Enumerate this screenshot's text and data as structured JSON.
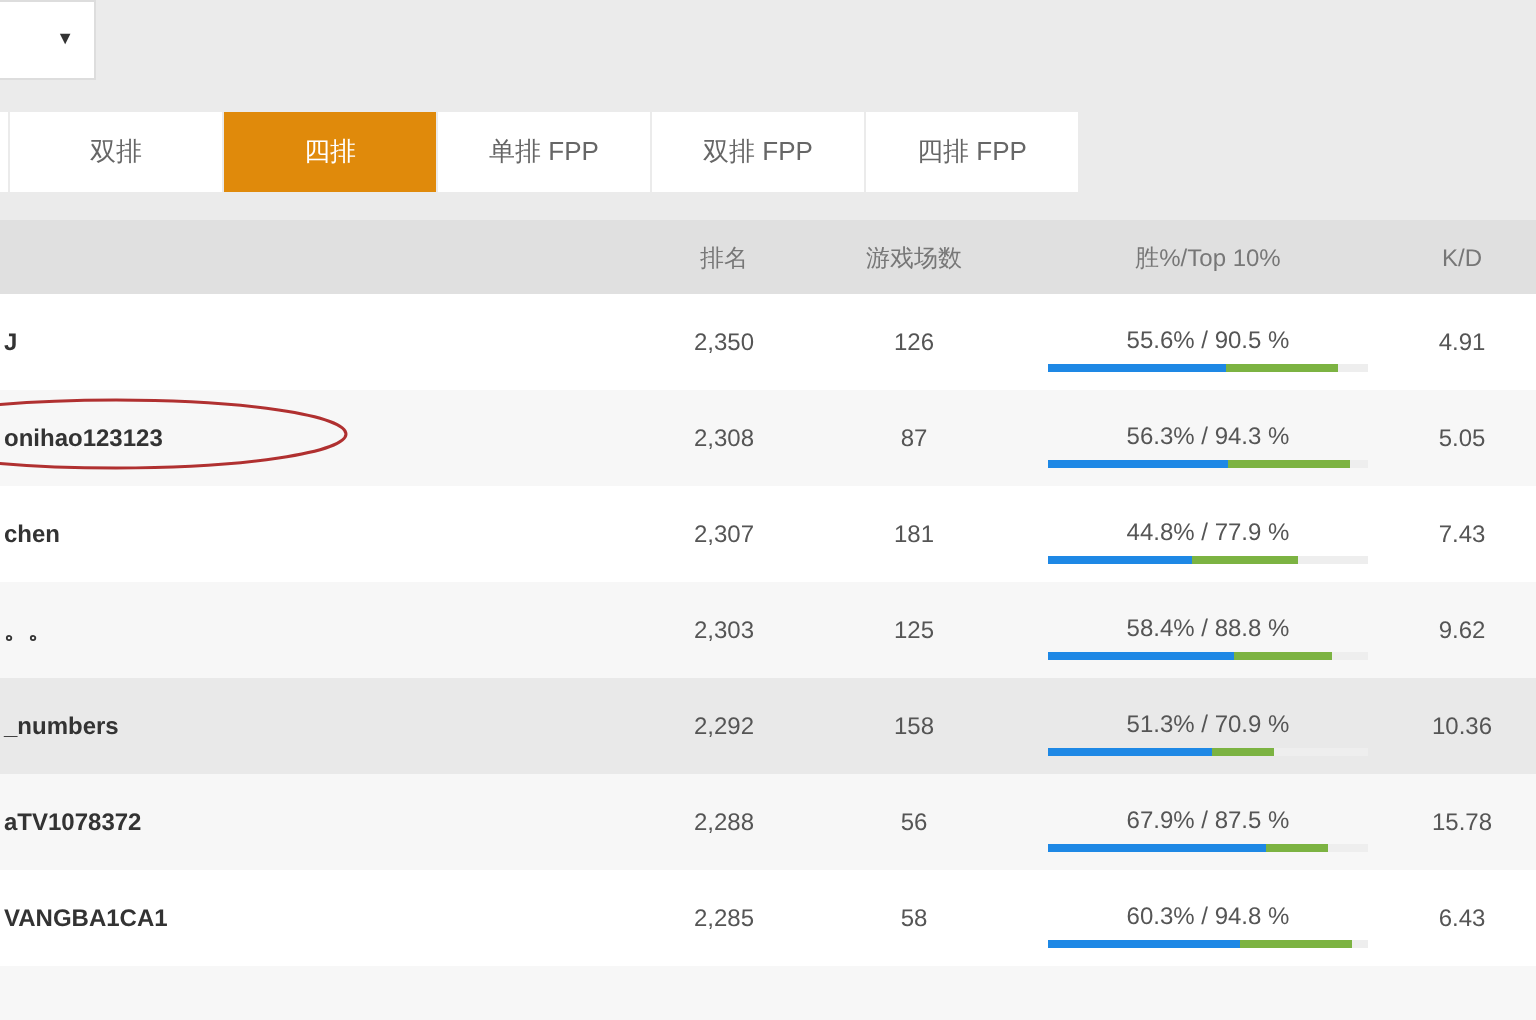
{
  "dropdown": {
    "caret": "▼"
  },
  "tabs": [
    {
      "selected": false
    },
    {
      "label": "双排",
      "selected": false
    },
    {
      "label": "四排",
      "selected": true
    },
    {
      "label": "单排 FPP",
      "selected": false
    },
    {
      "label": "双排 FPP",
      "selected": false
    },
    {
      "label": "四排 FPP",
      "selected": false
    }
  ],
  "table": {
    "columns": [
      "排名",
      "游戏场数",
      "胜%/Top 10%",
      "K/D"
    ],
    "rows": [
      {
        "name": "J",
        "rank": "2,350",
        "games": "126",
        "win_top": "55.6% / 90.5 %",
        "win_bar": {
          "level": 0.556
        },
        "top10_bar": {
          "level": 0.905
        },
        "kd": "4.91",
        "circled": false,
        "hovered": false
      },
      {
        "name": "onihao123123",
        "rank": "2,308",
        "games": "87",
        "win_top": "56.3% / 94.3 %",
        "win_bar": {
          "level": 0.563
        },
        "top10_bar": {
          "level": 0.943
        },
        "kd": "5.05",
        "circled": true,
        "hovered": false
      },
      {
        "name": "chen",
        "rank": "2,307",
        "games": "181",
        "win_top": "44.8% / 77.9 %",
        "win_bar": {
          "level": 0.448
        },
        "top10_bar": {
          "level": 0.779
        },
        "kd": "7.43",
        "circled": false,
        "hovered": false
      },
      {
        "name": "。。",
        "rank": "2,303",
        "games": "125",
        "win_top": "58.4% / 88.8 %",
        "win_bar": {
          "level": 0.584
        },
        "top10_bar": {
          "level": 0.888
        },
        "kd": "9.62",
        "circled": false,
        "hovered": false
      },
      {
        "name": "_numbers",
        "rank": "2,292",
        "games": "158",
        "win_top": "51.3% / 70.9 %",
        "win_bar": {
          "level": 0.513
        },
        "top10_bar": {
          "level": 0.709
        },
        "kd": "10.36",
        "circled": false,
        "hovered": true
      },
      {
        "name": "aTV1078372",
        "rank": "2,288",
        "games": "56",
        "win_top": "67.9% / 87.5 %",
        "win_bar": {
          "level": 0.679
        },
        "top10_bar": {
          "level": 0.875
        },
        "kd": "15.78",
        "circled": false,
        "hovered": false
      },
      {
        "name": "VANGBA1CA1",
        "rank": "2,285",
        "games": "58",
        "win_top": "60.3% / 94.8 %",
        "win_bar": {
          "level": 0.603
        },
        "top10_bar": {
          "level": 0.948
        },
        "kd": "6.43",
        "circled": false,
        "hovered": false
      }
    ]
  }
}
